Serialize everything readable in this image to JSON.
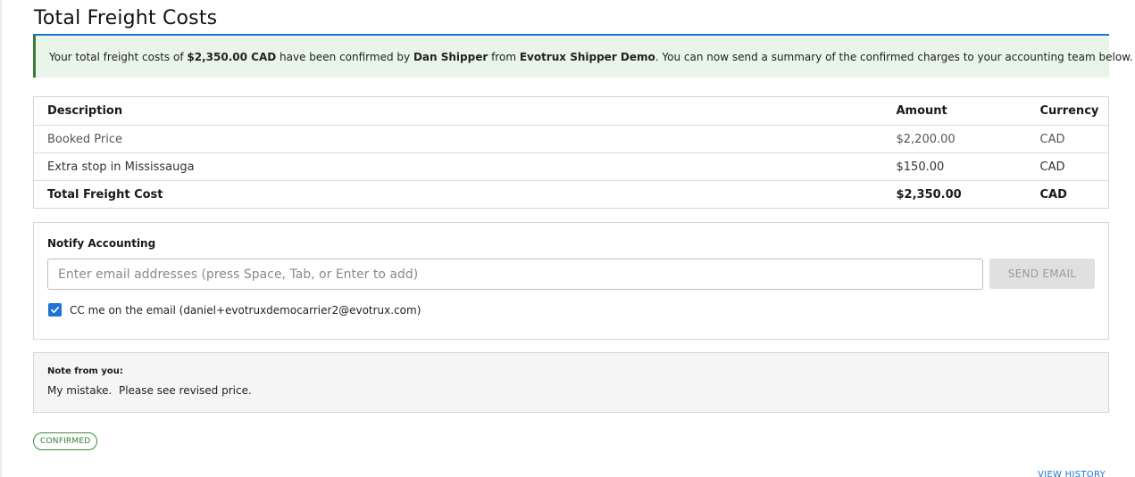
{
  "page": {
    "title": "Total Freight Costs"
  },
  "banner": {
    "prefix": "Your total freight costs of ",
    "amount": "$2,350.00 CAD",
    "mid1": " have been confirmed by ",
    "person": "Dan Shipper",
    "mid2": " from ",
    "company": "Evotrux Shipper Demo",
    "suffix": ". You can now send a summary of the confirmed charges to your accounting team below."
  },
  "table": {
    "headers": {
      "description": "Description",
      "amount": "Amount",
      "currency": "Currency"
    },
    "rows": [
      {
        "description": "Booked Price",
        "amount": "$2,200.00",
        "currency": "CAD"
      },
      {
        "description": "Extra stop in Mississauga",
        "amount": "$150.00",
        "currency": "CAD"
      }
    ],
    "total": {
      "description": "Total Freight Cost",
      "amount": "$2,350.00",
      "currency": "CAD"
    }
  },
  "notify": {
    "title": "Notify Accounting",
    "email_placeholder": "Enter email addresses (press Space, Tab, or Enter to add)",
    "email_value": "",
    "send_label": "SEND EMAIL",
    "cc_label": "CC me on the email (daniel+evotruxdemocarrier2@evotrux.com)",
    "cc_checked": true
  },
  "note": {
    "label": "Note from you:",
    "text": "My mistake.  Please see revised price."
  },
  "status": {
    "badge": "CONFIRMED"
  },
  "links": {
    "view_history": "VIEW HISTORY"
  },
  "colors": {
    "accent": "#1e73d8",
    "success_bg": "#e8f5e8",
    "success_border": "#3b7a3b",
    "badge_green": "#2e7d32",
    "disabled_button": "#e0e0e0"
  },
  "icons": {
    "checkbox": "checkmark-icon"
  }
}
